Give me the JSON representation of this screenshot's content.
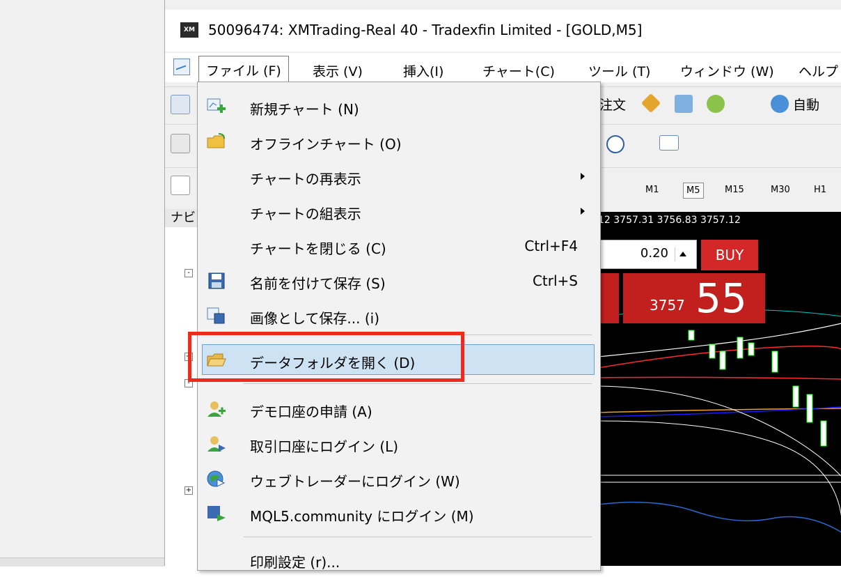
{
  "window": {
    "title": "50096474: XMTrading-Real 40 - Tradexfin Limited - [GOLD,M5]",
    "logo_text": "XM"
  },
  "menubar": {
    "items": [
      "ファイル (F)",
      "表示 (V)",
      "挿入(I)",
      "チャート(C)",
      "ツール (T)",
      "ウィンドウ (W)",
      "ヘルプ"
    ]
  },
  "toolbar": {
    "order_text": "注文",
    "auto_text": "自動",
    "timeframes": [
      "M1",
      "M5",
      "M15",
      "M30",
      "H1"
    ],
    "selected_timeframe": "M5"
  },
  "navigator": {
    "header": "ナビ"
  },
  "chart": {
    "price_line": "12 3757.31 3756.83 3757.12",
    "lot_value": "0.20",
    "buy_label": "BUY",
    "buy_price_prefix": "3757",
    "buy_price_big": "55"
  },
  "file_menu": {
    "items": [
      {
        "label": "新規チャート (N)",
        "icon": "new-chart-icon"
      },
      {
        "label": "オフラインチャート (O)",
        "icon": "offline-chart-folder-icon"
      },
      {
        "label": "チャートの再表示",
        "submenu": true
      },
      {
        "label": "チャートの組表示",
        "submenu": true
      },
      {
        "label": "チャートを閉じる (C)",
        "shortcut": "Ctrl+F4"
      },
      {
        "label": "名前を付けて保存 (S)",
        "shortcut": "Ctrl+S",
        "icon": "save-icon"
      },
      {
        "label": "画像として保存... (i)",
        "icon": "save-image-icon"
      },
      {
        "label": "データフォルダを開く (D)",
        "icon": "open-folder-icon",
        "highlighted": true
      },
      {
        "label": "デモ口座の申請 (A)",
        "icon": "demo-account-icon"
      },
      {
        "label": "取引口座にログイン (L)",
        "icon": "login-trade-icon"
      },
      {
        "label": "ウェブトレーダーにログイン (W)",
        "icon": "web-trader-icon"
      },
      {
        "label": "MQL5.community にログイン (M)",
        "icon": "mql5-icon"
      },
      {
        "label": "印刷設定 (r)..."
      }
    ]
  },
  "colors": {
    "highlight": "#cde3f4",
    "annotation_frame": "#ee2a1a",
    "buy_red": "#c21f1f"
  }
}
